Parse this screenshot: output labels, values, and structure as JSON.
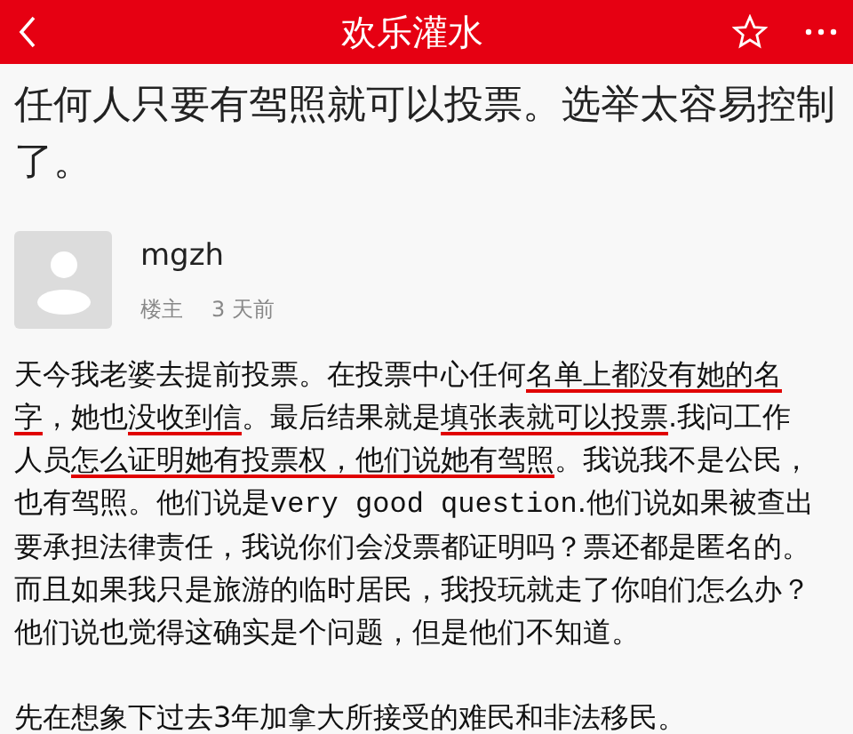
{
  "header": {
    "title": "欢乐灌水"
  },
  "post": {
    "title": "任何人只要有驾照就可以投票。选举太容易控制了。",
    "author": {
      "name": "mgzh",
      "role": "楼主",
      "time": "3 天前"
    },
    "paragraphs": [
      {
        "segments": [
          {
            "text": "天今我老婆去提前投票。在投票中心任何",
            "underlined": false
          },
          {
            "text": "名单上都没有她的名字",
            "underlined": true
          },
          {
            "text": "，她也",
            "underlined": false
          },
          {
            "text": "没收到信",
            "underlined": true
          },
          {
            "text": "。最后结果就是",
            "underlined": false
          },
          {
            "text": "填张表就可以投票",
            "underlined": true
          },
          {
            "text": ".我问工作人员",
            "underlined": false
          },
          {
            "text": "怎么证明她有投票权，他们说她有驾照",
            "underlined": true
          },
          {
            "text": "。我说我不是公民，也有驾照。他们说是",
            "underlined": false
          },
          {
            "text": "very good question",
            "underlined": false,
            "kind": "mono"
          },
          {
            "text": ".他们说如果被查出要承担法律责任，我说你们会没票都证明吗？票还都是匿名的。而且如果我只是旅游的临时居民，我投玩就走了你咱们怎么办？他们说也觉得这确实是个问题，但是他们不知道。",
            "underlined": false
          }
        ]
      },
      {
        "segments": [
          {
            "text": "先在想象下过去3年加拿大所接受的难民和非法移民。",
            "underlined": false
          }
        ]
      }
    ]
  }
}
